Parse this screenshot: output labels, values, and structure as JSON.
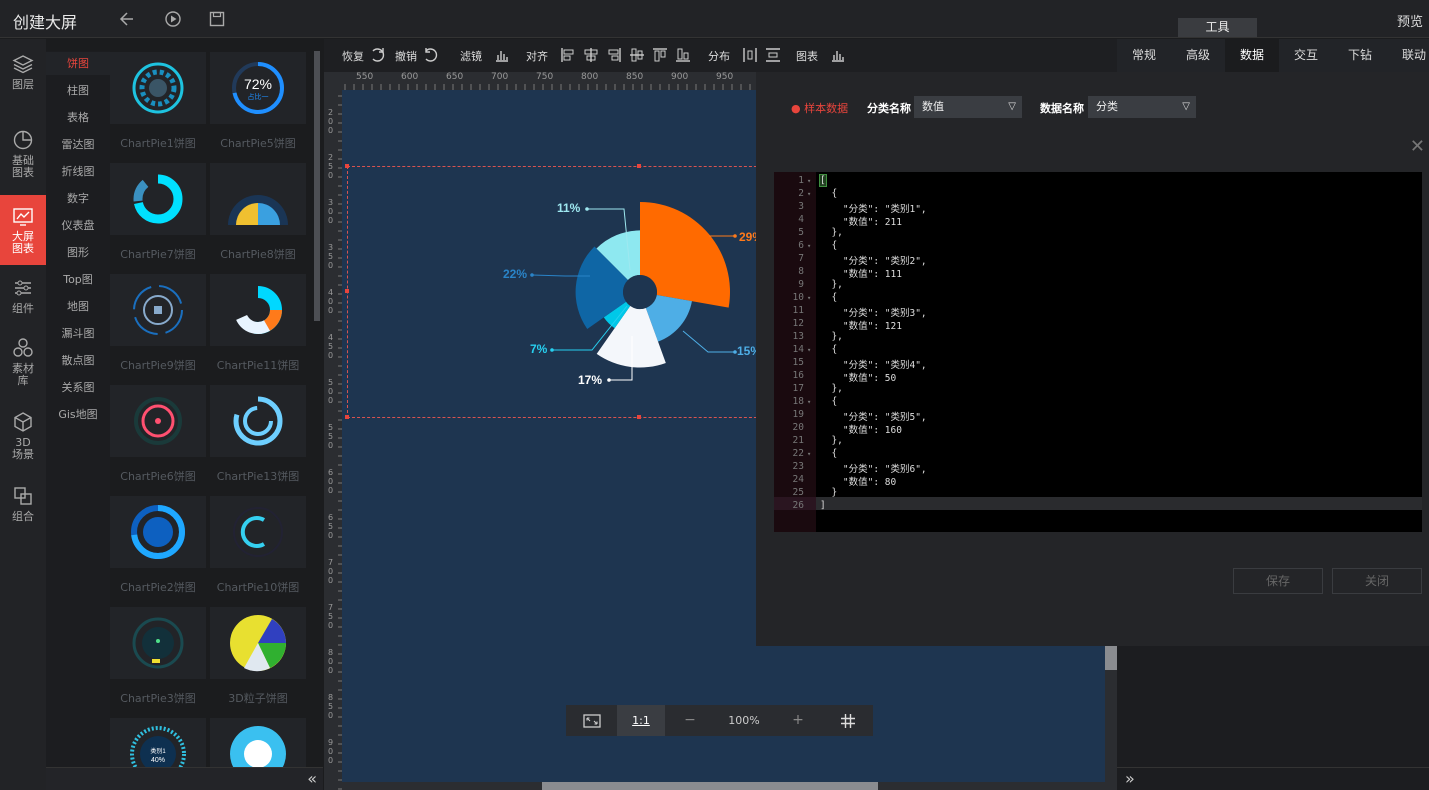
{
  "header": {
    "title": "创建大屏",
    "tools_tab": "工具",
    "preview": "预览"
  },
  "leftnav": [
    {
      "label": "图层",
      "icon": "layers-icon"
    },
    {
      "label": "基础\n图表",
      "icon": "pie-chart-icon"
    },
    {
      "label": "大屏\n图表",
      "icon": "screen-chart-icon",
      "active": true
    },
    {
      "label": "组件",
      "icon": "sliders-icon"
    },
    {
      "label": "素材\n库",
      "icon": "material-icon"
    },
    {
      "label": "3D\n场景",
      "icon": "cube-icon"
    },
    {
      "label": "组合",
      "icon": "group-icon"
    }
  ],
  "categories": [
    "饼图",
    "柱图",
    "表格",
    "雷达图",
    "折线图",
    "数字",
    "仪表盘",
    "图形",
    "Top图",
    "地图",
    "漏斗图",
    "散点图",
    "关系图",
    "Gis地图"
  ],
  "thumbs": [
    {
      "label": "ChartPie1饼图"
    },
    {
      "label": "ChartPie5饼图",
      "value": "72%",
      "sub": "占比一"
    },
    {
      "label": "ChartPie7饼图"
    },
    {
      "label": "ChartPie8饼图"
    },
    {
      "label": "ChartPie9饼图"
    },
    {
      "label": "ChartPie11饼图"
    },
    {
      "label": "ChartPie6饼图"
    },
    {
      "label": "ChartPie13饼图"
    },
    {
      "label": "ChartPie2饼图"
    },
    {
      "label": "ChartPie10饼图"
    },
    {
      "label": "ChartPie3饼图"
    },
    {
      "label": "3D粒子饼图"
    },
    {
      "label": "",
      "value": "类别1",
      "sub": "40%"
    },
    {
      "label": ""
    }
  ],
  "toolbar": {
    "redo": "恢复",
    "undo": "撤销",
    "filter": "滤镜",
    "align": "对齐",
    "distribute": "分布",
    "chart": "图表"
  },
  "ruler_h": [
    "550",
    "600",
    "650",
    "700",
    "750",
    "800",
    "850",
    "900",
    "950"
  ],
  "ruler_v": [
    "200",
    "250",
    "300",
    "350",
    "400",
    "450",
    "500",
    "550",
    "600",
    "650",
    "700",
    "750",
    "800",
    "850",
    "900"
  ],
  "canvas_chart": {
    "labels": [
      "11%",
      "22%",
      "7%",
      "17%",
      "15%",
      "29%"
    ]
  },
  "zoom": {
    "ratio": "1:1",
    "minus": "−",
    "level": "100%",
    "plus": "+"
  },
  "rtabs": [
    "常规",
    "高级",
    "数据",
    "交互",
    "下钻",
    "联动"
  ],
  "modal": {
    "sample": "样本数据",
    "category_label": "分类名称",
    "category_value": "数值",
    "data_label": "数据名称",
    "data_value": "分类",
    "save": "保存",
    "close": "关闭"
  },
  "chart_data": {
    "type": "pie",
    "categories": [
      "类别1",
      "类别2",
      "类别3",
      "类别4",
      "类别5",
      "类别6"
    ],
    "values": [
      211,
      111,
      121,
      50,
      160,
      80
    ],
    "title": ""
  },
  "json_lines": [
    "[",
    "  {",
    "    \"分类\": \"类别1\",",
    "    \"数值\": 211",
    "  },",
    "  {",
    "    \"分类\": \"类别2\",",
    "    \"数值\": 111",
    "  },",
    "  {",
    "    \"分类\": \"类别3\",",
    "    \"数值\": 121",
    "  },",
    "  {",
    "    \"分类\": \"类别4\",",
    "    \"数值\": 50",
    "  },",
    "  {",
    "    \"分类\": \"类别5\",",
    "    \"数值\": 160",
    "  },",
    "  {",
    "    \"分类\": \"类别6\",",
    "    \"数值\": 80",
    "  }",
    "]"
  ]
}
